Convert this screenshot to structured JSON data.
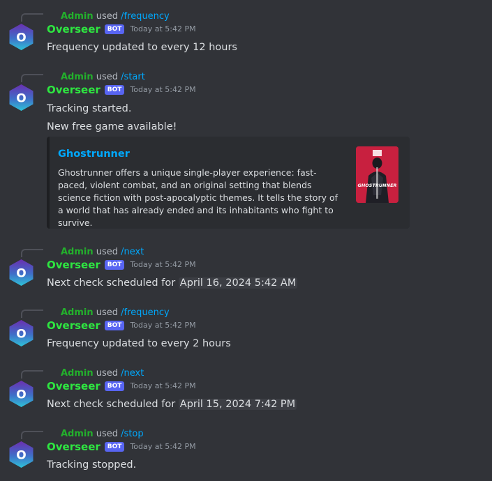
{
  "colors": {
    "background": "#313338",
    "bot_name": "#2ee641",
    "admin_name": "#23b02c",
    "command": "#00a8fc",
    "bot_tag": "#5865f2",
    "embed_bg": "#2b2d31"
  },
  "avatar": {
    "letter": "O",
    "icon": "overseer-avatar-icon"
  },
  "messages": [
    {
      "reply": {
        "user": "Admin",
        "used": "used",
        "command": "/frequency"
      },
      "author": "Overseer",
      "tag": "BOT",
      "timestamp": "Today at 5:42 PM",
      "text": "Frequency updated to every 12 hours"
    },
    {
      "reply": {
        "user": "Admin",
        "used": "used",
        "command": "/start"
      },
      "author": "Overseer",
      "tag": "BOT",
      "timestamp": "Today at 5:42 PM",
      "text": "Tracking started.",
      "text2": "New free game available!",
      "embed": {
        "title": "Ghostrunner",
        "description": "Ghostrunner offers a unique single-player experience: fast-paced, violent combat, and an original setting that blends science fiction with post-apocalyptic themes. It tells the story of a world that has already ended and its inhabitants who fight to survive.",
        "thumbnail_logo_text": "GHOSTRUNNER"
      }
    },
    {
      "reply": {
        "user": "Admin",
        "used": "used",
        "command": "/next"
      },
      "author": "Overseer",
      "tag": "BOT",
      "timestamp": "Today at 5:42 PM",
      "text": "Next check scheduled for",
      "date": "April 16, 2024 5:42 AM"
    },
    {
      "reply": {
        "user": "Admin",
        "used": "used",
        "command": "/frequency"
      },
      "author": "Overseer",
      "tag": "BOT",
      "timestamp": "Today at 5:42 PM",
      "text": "Frequency updated to every 2 hours"
    },
    {
      "reply": {
        "user": "Admin",
        "used": "used",
        "command": "/next"
      },
      "author": "Overseer",
      "tag": "BOT",
      "timestamp": "Today at 5:42 PM",
      "text": "Next check scheduled for",
      "date": "April 15, 2024 7:42 PM"
    },
    {
      "reply": {
        "user": "Admin",
        "used": "used",
        "command": "/stop"
      },
      "author": "Overseer",
      "tag": "BOT",
      "timestamp": "Today at 5:42 PM",
      "text": "Tracking stopped."
    }
  ]
}
